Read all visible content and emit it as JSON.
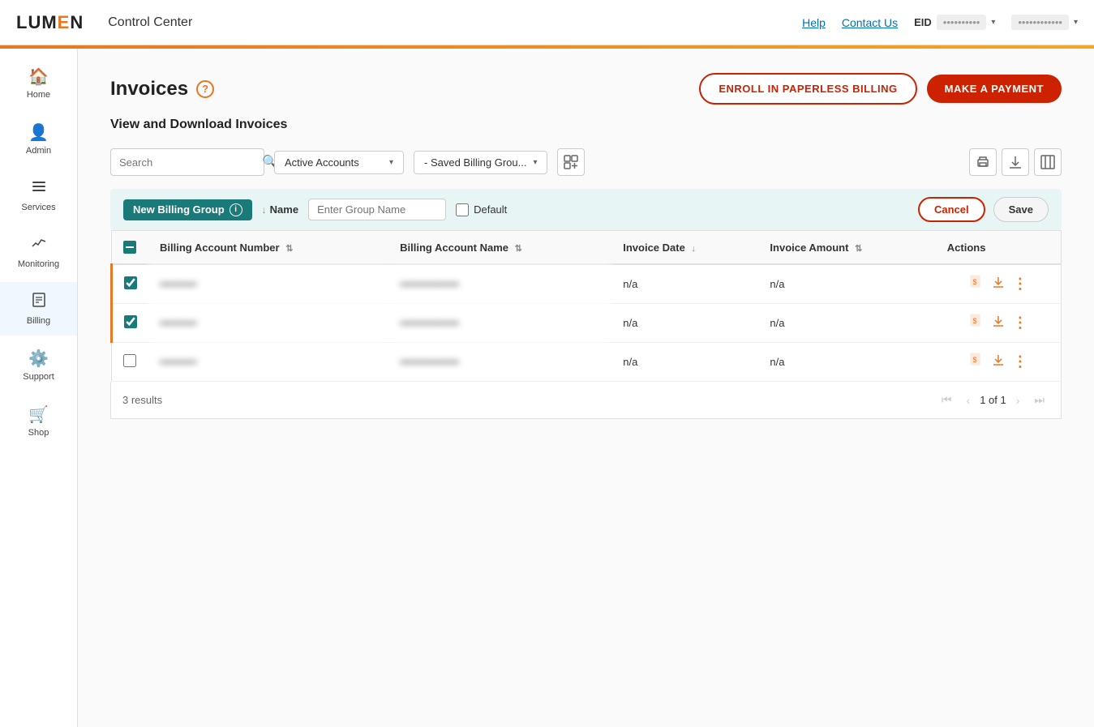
{
  "header": {
    "logo": "LUMEN",
    "app_title": "Control Center",
    "nav_links": [
      {
        "label": "Help",
        "id": "help"
      },
      {
        "label": "Contact Us",
        "id": "contact"
      }
    ],
    "eid_label": "EID",
    "eid_value": "••••••••••",
    "user_value": "••••••••••••"
  },
  "sidebar": {
    "items": [
      {
        "id": "home",
        "label": "Home",
        "icon": "🏠"
      },
      {
        "id": "admin",
        "label": "Admin",
        "icon": "👤"
      },
      {
        "id": "services",
        "label": "Services",
        "icon": "☰"
      },
      {
        "id": "monitoring",
        "label": "Monitoring",
        "icon": "📈"
      },
      {
        "id": "billing",
        "label": "Billing",
        "icon": "📄",
        "active": true
      },
      {
        "id": "support",
        "label": "Support",
        "icon": "⚙️"
      },
      {
        "id": "shop",
        "label": "Shop",
        "icon": "🛒"
      }
    ]
  },
  "page": {
    "title": "Invoices",
    "subtitle": "View and Download Invoices",
    "btn_paperless": "ENROLL IN PAPERLESS BILLING",
    "btn_payment": "MAKE A PAYMENT"
  },
  "filters": {
    "search_placeholder": "Search",
    "accounts_label": "Active Accounts",
    "billing_group_label": "- Saved Billing Grou..."
  },
  "new_billing_group": {
    "badge_label": "New Billing Group",
    "name_label": "Name",
    "group_name_placeholder": "Enter Group Name",
    "default_label": "Default",
    "btn_cancel": "Cancel",
    "btn_save": "Save"
  },
  "table": {
    "columns": [
      {
        "id": "select",
        "label": ""
      },
      {
        "id": "account_number",
        "label": "Billing Account Number",
        "sortable": true
      },
      {
        "id": "account_name",
        "label": "Billing Account Name",
        "sortable": true
      },
      {
        "id": "invoice_date",
        "label": "Invoice Date",
        "sortable": true
      },
      {
        "id": "invoice_amount",
        "label": "Invoice Amount",
        "sortable": true
      },
      {
        "id": "actions",
        "label": "Actions"
      }
    ],
    "rows": [
      {
        "id": "row1",
        "checked": true,
        "account_number": "••••••••••",
        "account_name": "••••••••••••••••",
        "invoice_date": "n/a",
        "invoice_amount": "n/a",
        "highlighted": true
      },
      {
        "id": "row2",
        "checked": true,
        "account_number": "••••••••••",
        "account_name": "••••••••••••••••",
        "invoice_date": "n/a",
        "invoice_amount": "n/a",
        "highlighted": true
      },
      {
        "id": "row3",
        "checked": false,
        "account_number": "••••••••••",
        "account_name": "••••••••••••••••",
        "invoice_date": "n/a",
        "invoice_amount": "n/a",
        "highlighted": false
      }
    ]
  },
  "pagination": {
    "results_label": "3 results",
    "current_page": "1",
    "total_pages": "1",
    "page_display": "1 of 1"
  }
}
